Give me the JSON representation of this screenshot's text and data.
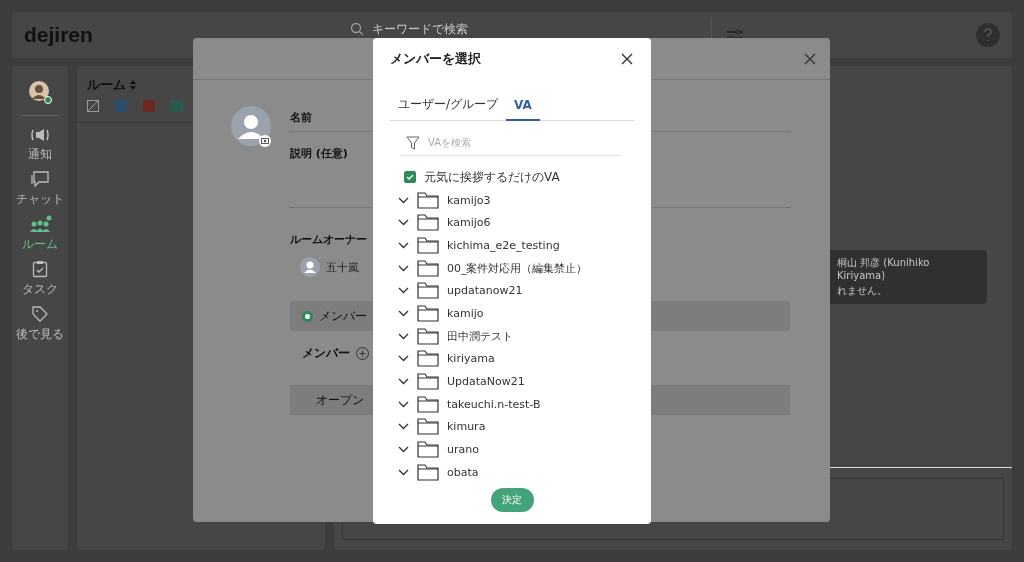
{
  "app": {
    "logo": "dejiren",
    "search": {
      "placeholder": "キーワードで検索"
    },
    "nav": [
      {
        "kind": "bell",
        "label": "通知",
        "selected": false
      },
      {
        "kind": "chat",
        "label": "チャット",
        "selected": false
      },
      {
        "kind": "room",
        "label": "ルーム",
        "selected": true
      },
      {
        "kind": "task",
        "label": "タスク",
        "selected": false
      },
      {
        "kind": "tag",
        "label": "後で見る",
        "selected": false
      }
    ],
    "room_panel": {
      "title": "ルーム",
      "filters": [
        {
          "kind": "none"
        },
        {
          "kind": "color",
          "color": "#2c4d6b"
        },
        {
          "kind": "color",
          "color": "#6a2a22"
        },
        {
          "kind": "color",
          "color": "#2a5a52"
        }
      ]
    },
    "notice": {
      "lines": [
        "桐山 邦彦 (Kunihiko Kiriyama)",
        "れません。"
      ]
    }
  },
  "room_dialog": {
    "fields": [
      {
        "label": "名前"
      },
      {
        "label": "説明 (任意)"
      }
    ],
    "owner": {
      "label": "ルームオーナー",
      "name": "五十嵐"
    },
    "radio": {
      "label": "メンバー",
      "selected": true
    },
    "members": {
      "label": "メンバー"
    },
    "open": {
      "label": "オープン"
    }
  },
  "member_dialog": {
    "title": "メンバーを選択",
    "tabs": [
      {
        "label": "ユーザー/グループ",
        "selected": false
      },
      {
        "label": "VA",
        "selected": true
      }
    ],
    "search": {
      "placeholder": "VAを検索"
    },
    "check": {
      "label": "元気に挨拶するだけのVA",
      "checked": true
    },
    "folders": [
      "kamijo3",
      "kamijo6",
      "kichima_e2e_testing",
      "00_案件対応用（編集禁止）",
      "updatanow21",
      "kamijo",
      "田中潤テスト",
      "kiriyama",
      "UpdataNow21",
      "takeuchi.n-test-B",
      "kimura",
      "urano",
      "obata"
    ],
    "submit": "決定"
  }
}
